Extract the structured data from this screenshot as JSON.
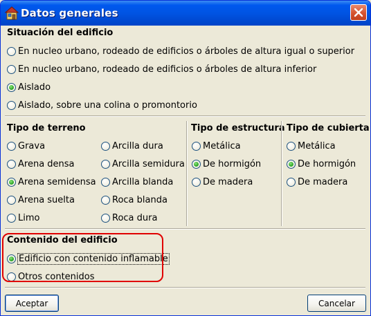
{
  "window": {
    "title": "Datos generales"
  },
  "situacion": {
    "header": "Situación del edificio",
    "options": [
      {
        "label": "En nucleo urbano, rodeado de edificios o árboles de altura igual o superior",
        "checked": false
      },
      {
        "label": "En nucleo urbano, rodeado de edificios o árboles de altura inferior",
        "checked": false
      },
      {
        "label": "Aislado",
        "checked": true
      },
      {
        "label": "Aislado, sobre una colina o promontorio",
        "checked": false
      }
    ]
  },
  "terreno": {
    "header": "Tipo de terreno",
    "col1": [
      {
        "label": "Grava",
        "checked": false
      },
      {
        "label": "Arena densa",
        "checked": false
      },
      {
        "label": "Arena semidensa",
        "checked": true
      },
      {
        "label": "Arena suelta",
        "checked": false
      },
      {
        "label": "Limo",
        "checked": false
      }
    ],
    "col2": [
      {
        "label": "Arcilla dura",
        "checked": false
      },
      {
        "label": "Arcilla semidura",
        "checked": false
      },
      {
        "label": "Arcilla blanda",
        "checked": false
      },
      {
        "label": "Roca blanda",
        "checked": false
      },
      {
        "label": "Roca dura",
        "checked": false
      }
    ]
  },
  "estructura": {
    "header": "Tipo de estructura",
    "options": [
      {
        "label": "Metálica",
        "checked": false
      },
      {
        "label": "De hormigón",
        "checked": true
      },
      {
        "label": "De madera",
        "checked": false
      }
    ]
  },
  "cubierta": {
    "header": "Tipo de cubierta",
    "options": [
      {
        "label": "Metálica",
        "checked": false
      },
      {
        "label": "De hormigón",
        "checked": true
      },
      {
        "label": "De madera",
        "checked": false
      }
    ]
  },
  "contenido": {
    "header": "Contenido del edificio",
    "options": [
      {
        "label": "Edificio con contenido inflamable",
        "checked": true
      },
      {
        "label": "Otros contenidos",
        "checked": false
      }
    ]
  },
  "buttons": {
    "accept": "Aceptar",
    "cancel": "Cancelar"
  },
  "colors": {
    "titlebar": "#0054E3",
    "highlight": "#E00000",
    "radio_checked": "#2FA82C"
  }
}
